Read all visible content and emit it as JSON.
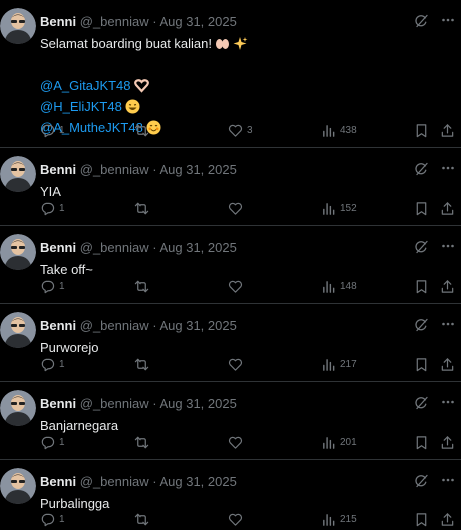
{
  "author": {
    "name": "Benni",
    "handle": "@_benniaw",
    "date": "Aug 31, 2025",
    "separator": "·"
  },
  "tweets": [
    {
      "text_lines": [
        "Selamat boarding buat kalian!"
      ],
      "mentions": [
        "@A_GitaJKT48",
        "@H_EliJKT48",
        "@A_MutheJKT48"
      ],
      "emojis": [
        "open-hands-emoji",
        "sparkles-emoji",
        "heart-hands-emoji",
        "grinning-face-emoji",
        "smiling-face-emoji"
      ],
      "replies": "1",
      "reposts": "",
      "likes": "3",
      "views": "438"
    },
    {
      "text_lines": [
        "YIA"
      ],
      "replies": "1",
      "reposts": "",
      "likes": "",
      "views": "152"
    },
    {
      "text_lines": [
        "Take off~"
      ],
      "replies": "1",
      "reposts": "",
      "likes": "",
      "views": "148"
    },
    {
      "text_lines": [
        "Purworejo"
      ],
      "replies": "1",
      "reposts": "",
      "likes": "",
      "views": "217"
    },
    {
      "text_lines": [
        "Banjarnegara"
      ],
      "replies": "1",
      "reposts": "",
      "likes": "",
      "views": "201"
    },
    {
      "text_lines": [
        "Purbalingga"
      ],
      "replies": "1",
      "reposts": "",
      "likes": "",
      "views": "215"
    }
  ],
  "colors": {
    "background": "#000000",
    "text": "#e7e9ea",
    "muted": "#71767b",
    "link": "#1d9bf0",
    "divider": "#2f3336"
  },
  "icons": [
    "reply-icon",
    "repost-icon",
    "like-icon",
    "views-icon",
    "bookmark-icon",
    "share-icon",
    "grok-icon",
    "more-icon"
  ]
}
